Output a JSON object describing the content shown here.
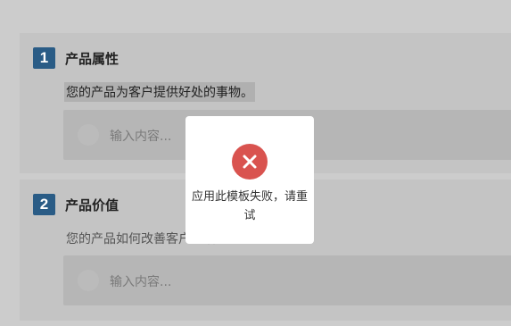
{
  "sections": [
    {
      "number": "1",
      "title": "产品属性",
      "description": "您的产品为客户提供好处的事物。",
      "input_placeholder": "输入内容..."
    },
    {
      "number": "2",
      "title": "产品价值",
      "description": "您的产品如何改善客户生活",
      "input_placeholder": "输入内容..."
    }
  ],
  "toast": {
    "icon": "error-x-icon",
    "icon_color": "#d9534f",
    "line1": "应用此模板失败，请重",
    "line2": "试"
  },
  "colors": {
    "badge": "#2a5c86",
    "background": "#cccccc"
  }
}
